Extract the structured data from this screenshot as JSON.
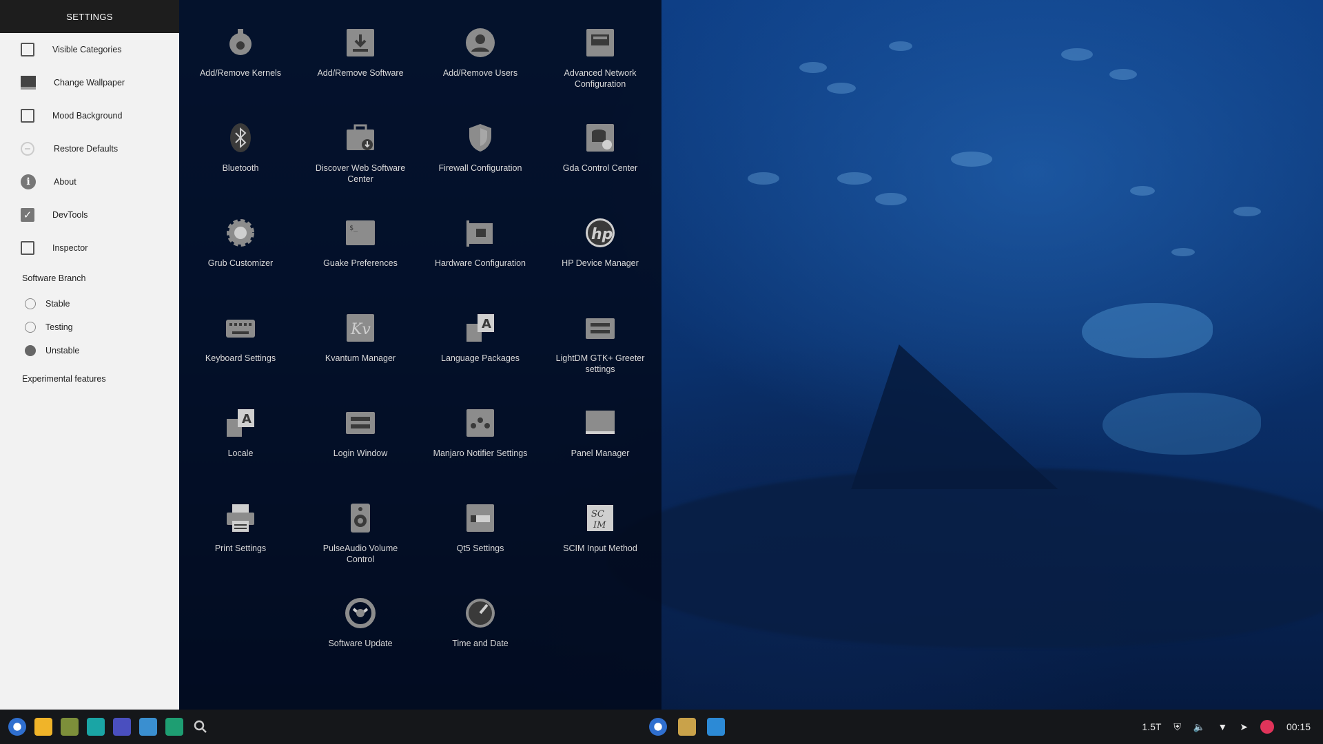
{
  "settings": {
    "header": "SETTINGS",
    "toggles": [
      {
        "label": "Visible Categories",
        "type": "checkbox",
        "checked": false
      },
      {
        "label": "Change Wallpaper",
        "type": "wallpaper"
      },
      {
        "label": "Mood Background",
        "type": "checkbox",
        "checked": false
      },
      {
        "label": "Restore Defaults",
        "type": "restore"
      },
      {
        "label": "About",
        "type": "about"
      },
      {
        "label": "DevTools",
        "type": "checkbox",
        "checked": true
      },
      {
        "label": "Inspector",
        "type": "checkbox",
        "checked": false
      }
    ],
    "branch_label": "Software Branch",
    "branches": [
      {
        "label": "Stable",
        "selected": false
      },
      {
        "label": "Testing",
        "selected": false
      },
      {
        "label": "Unstable",
        "selected": true
      }
    ],
    "experimental_label": "Experimental features"
  },
  "apps": [
    {
      "label": "Add/Remove Kernels",
      "icon": "kernel-icon"
    },
    {
      "label": "Add/Remove Software",
      "icon": "download-icon"
    },
    {
      "label": "Add/Remove Users",
      "icon": "user-icon"
    },
    {
      "label": "Advanced Network Configuration",
      "icon": "network-icon"
    },
    {
      "label": "Bluetooth",
      "icon": "bluetooth-icon"
    },
    {
      "label": "Discover Web Software Center",
      "icon": "briefcase-icon"
    },
    {
      "label": "Firewall Configuration",
      "icon": "shield-icon"
    },
    {
      "label": "Gda Control Center",
      "icon": "database-icon"
    },
    {
      "label": "Grub Customizer",
      "icon": "gear-icon"
    },
    {
      "label": "Guake Preferences",
      "icon": "terminal-icon"
    },
    {
      "label": "Hardware Configuration",
      "icon": "hardware-icon"
    },
    {
      "label": "HP Device Manager",
      "icon": "hp-icon"
    },
    {
      "label": "Keyboard Settings",
      "icon": "keyboard-icon"
    },
    {
      "label": "Kvantum Manager",
      "icon": "kvantum-icon"
    },
    {
      "label": "Language Packages",
      "icon": "language-icon"
    },
    {
      "label": "LightDM GTK+ Greeter settings",
      "icon": "lightdm-icon"
    },
    {
      "label": "Locale",
      "icon": "locale-icon"
    },
    {
      "label": "Login Window",
      "icon": "login-icon"
    },
    {
      "label": "Manjaro Notifier Settings",
      "icon": "notifier-icon"
    },
    {
      "label": "Panel Manager",
      "icon": "panel-icon"
    },
    {
      "label": "Print Settings",
      "icon": "printer-icon"
    },
    {
      "label": "PulseAudio Volume Control",
      "icon": "speaker-icon"
    },
    {
      "label": "Qt5 Settings",
      "icon": "qt-icon"
    },
    {
      "label": "SCIM Input Method",
      "icon": "scim-icon"
    },
    {
      "label": "",
      "icon": ""
    },
    {
      "label": "Software Update",
      "icon": "update-icon"
    },
    {
      "label": "Time and Date",
      "icon": "clock-icon"
    }
  ],
  "taskbar": {
    "left_icons": [
      {
        "name": "chromium-icon",
        "color": "#2f6fcf"
      },
      {
        "name": "mail-icon",
        "color": "#f0b429"
      },
      {
        "name": "files-icon",
        "color": "#7d8f3a"
      },
      {
        "name": "apps-grid-icon",
        "color": "#1aa5a5"
      },
      {
        "name": "dots-icon",
        "color": "#4a4fbf"
      },
      {
        "name": "window-manager-icon",
        "color": "#3a8fd0"
      },
      {
        "name": "chat-icon",
        "color": "#1e9e72"
      },
      {
        "name": "search-icon",
        "color": "#cccccc"
      }
    ],
    "center_icons": [
      {
        "name": "chromium-icon",
        "color": "#2f6fcf"
      },
      {
        "name": "files-icon",
        "color": "#c9a24a"
      },
      {
        "name": "vscode-icon",
        "color": "#2c8ad6"
      }
    ],
    "tray": {
      "storage": "1.5T",
      "clock": "00:15"
    }
  }
}
